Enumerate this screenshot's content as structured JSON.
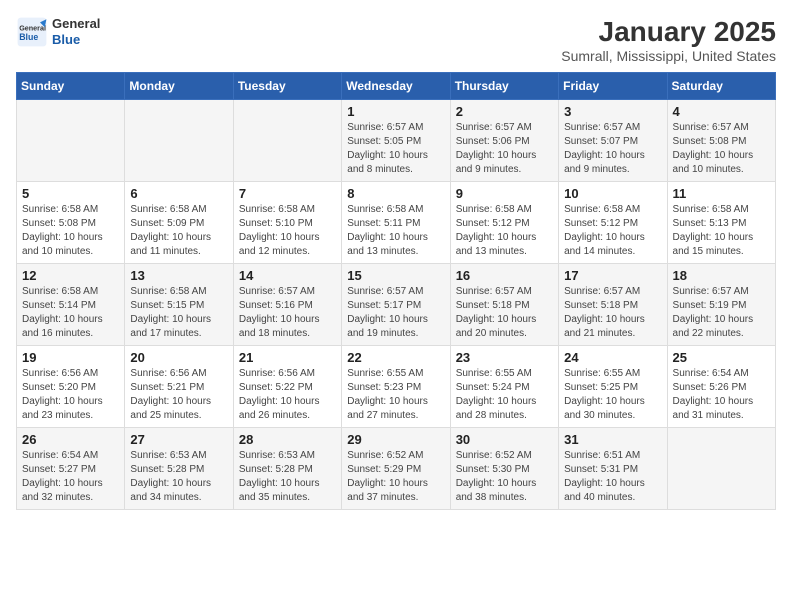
{
  "header": {
    "logo_line1": "General",
    "logo_line2": "Blue",
    "title": "January 2025",
    "subtitle": "Sumrall, Mississippi, United States"
  },
  "weekdays": [
    "Sunday",
    "Monday",
    "Tuesday",
    "Wednesday",
    "Thursday",
    "Friday",
    "Saturday"
  ],
  "weeks": [
    [
      {
        "day": "",
        "info": ""
      },
      {
        "day": "",
        "info": ""
      },
      {
        "day": "",
        "info": ""
      },
      {
        "day": "1",
        "info": "Sunrise: 6:57 AM\nSunset: 5:05 PM\nDaylight: 10 hours and 8 minutes."
      },
      {
        "day": "2",
        "info": "Sunrise: 6:57 AM\nSunset: 5:06 PM\nDaylight: 10 hours and 9 minutes."
      },
      {
        "day": "3",
        "info": "Sunrise: 6:57 AM\nSunset: 5:07 PM\nDaylight: 10 hours and 9 minutes."
      },
      {
        "day": "4",
        "info": "Sunrise: 6:57 AM\nSunset: 5:08 PM\nDaylight: 10 hours and 10 minutes."
      }
    ],
    [
      {
        "day": "5",
        "info": "Sunrise: 6:58 AM\nSunset: 5:08 PM\nDaylight: 10 hours and 10 minutes."
      },
      {
        "day": "6",
        "info": "Sunrise: 6:58 AM\nSunset: 5:09 PM\nDaylight: 10 hours and 11 minutes."
      },
      {
        "day": "7",
        "info": "Sunrise: 6:58 AM\nSunset: 5:10 PM\nDaylight: 10 hours and 12 minutes."
      },
      {
        "day": "8",
        "info": "Sunrise: 6:58 AM\nSunset: 5:11 PM\nDaylight: 10 hours and 13 minutes."
      },
      {
        "day": "9",
        "info": "Sunrise: 6:58 AM\nSunset: 5:12 PM\nDaylight: 10 hours and 13 minutes."
      },
      {
        "day": "10",
        "info": "Sunrise: 6:58 AM\nSunset: 5:12 PM\nDaylight: 10 hours and 14 minutes."
      },
      {
        "day": "11",
        "info": "Sunrise: 6:58 AM\nSunset: 5:13 PM\nDaylight: 10 hours and 15 minutes."
      }
    ],
    [
      {
        "day": "12",
        "info": "Sunrise: 6:58 AM\nSunset: 5:14 PM\nDaylight: 10 hours and 16 minutes."
      },
      {
        "day": "13",
        "info": "Sunrise: 6:58 AM\nSunset: 5:15 PM\nDaylight: 10 hours and 17 minutes."
      },
      {
        "day": "14",
        "info": "Sunrise: 6:57 AM\nSunset: 5:16 PM\nDaylight: 10 hours and 18 minutes."
      },
      {
        "day": "15",
        "info": "Sunrise: 6:57 AM\nSunset: 5:17 PM\nDaylight: 10 hours and 19 minutes."
      },
      {
        "day": "16",
        "info": "Sunrise: 6:57 AM\nSunset: 5:18 PM\nDaylight: 10 hours and 20 minutes."
      },
      {
        "day": "17",
        "info": "Sunrise: 6:57 AM\nSunset: 5:18 PM\nDaylight: 10 hours and 21 minutes."
      },
      {
        "day": "18",
        "info": "Sunrise: 6:57 AM\nSunset: 5:19 PM\nDaylight: 10 hours and 22 minutes."
      }
    ],
    [
      {
        "day": "19",
        "info": "Sunrise: 6:56 AM\nSunset: 5:20 PM\nDaylight: 10 hours and 23 minutes."
      },
      {
        "day": "20",
        "info": "Sunrise: 6:56 AM\nSunset: 5:21 PM\nDaylight: 10 hours and 25 minutes."
      },
      {
        "day": "21",
        "info": "Sunrise: 6:56 AM\nSunset: 5:22 PM\nDaylight: 10 hours and 26 minutes."
      },
      {
        "day": "22",
        "info": "Sunrise: 6:55 AM\nSunset: 5:23 PM\nDaylight: 10 hours and 27 minutes."
      },
      {
        "day": "23",
        "info": "Sunrise: 6:55 AM\nSunset: 5:24 PM\nDaylight: 10 hours and 28 minutes."
      },
      {
        "day": "24",
        "info": "Sunrise: 6:55 AM\nSunset: 5:25 PM\nDaylight: 10 hours and 30 minutes."
      },
      {
        "day": "25",
        "info": "Sunrise: 6:54 AM\nSunset: 5:26 PM\nDaylight: 10 hours and 31 minutes."
      }
    ],
    [
      {
        "day": "26",
        "info": "Sunrise: 6:54 AM\nSunset: 5:27 PM\nDaylight: 10 hours and 32 minutes."
      },
      {
        "day": "27",
        "info": "Sunrise: 6:53 AM\nSunset: 5:28 PM\nDaylight: 10 hours and 34 minutes."
      },
      {
        "day": "28",
        "info": "Sunrise: 6:53 AM\nSunset: 5:28 PM\nDaylight: 10 hours and 35 minutes."
      },
      {
        "day": "29",
        "info": "Sunrise: 6:52 AM\nSunset: 5:29 PM\nDaylight: 10 hours and 37 minutes."
      },
      {
        "day": "30",
        "info": "Sunrise: 6:52 AM\nSunset: 5:30 PM\nDaylight: 10 hours and 38 minutes."
      },
      {
        "day": "31",
        "info": "Sunrise: 6:51 AM\nSunset: 5:31 PM\nDaylight: 10 hours and 40 minutes."
      },
      {
        "day": "",
        "info": ""
      }
    ]
  ]
}
